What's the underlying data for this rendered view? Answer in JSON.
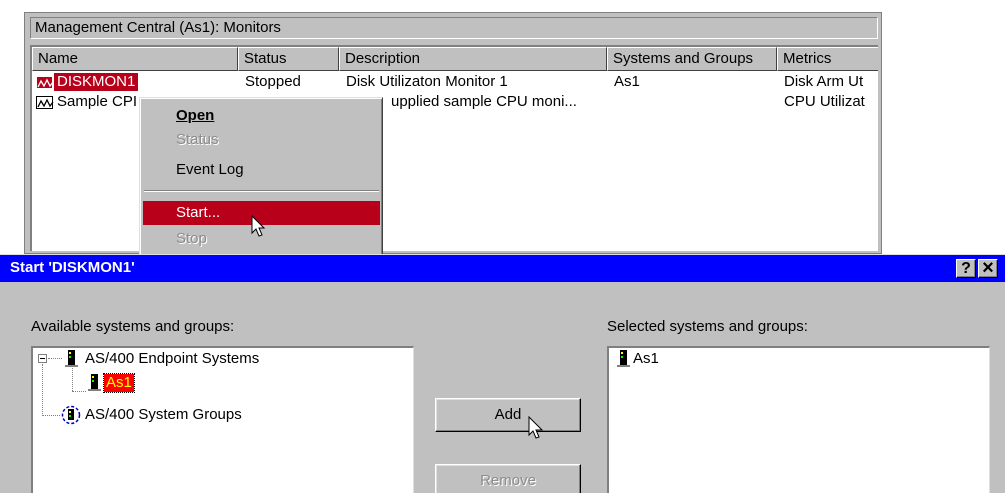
{
  "monitors_window": {
    "title": "Management Central (As1):  Monitors",
    "columns": [
      "Name",
      "Status",
      "Description",
      "Systems and Groups",
      "Metrics"
    ],
    "rows": [
      {
        "name": "DISKMON1",
        "status": "Stopped",
        "description": "Disk Utilizaton Monitor 1",
        "systems": "As1",
        "metrics": "Disk Arm Ut",
        "selected": true
      },
      {
        "name": "Sample CPI",
        "status": "",
        "description": "upplied sample CPU moni...",
        "systems": "",
        "metrics": "CPU Utilizat",
        "selected": false
      }
    ]
  },
  "context_menu": {
    "open": "Open",
    "status": "Status",
    "event_log": "Event Log",
    "start": "Start...",
    "stop": "Stop"
  },
  "dialog": {
    "title": "Start 'DISKMON1'",
    "help_glyph": "?",
    "close_glyph": "×",
    "available_label": "Available systems and groups:",
    "selected_label": "Selected systems and groups:",
    "tree": {
      "endpoint_systems": "AS/400 Endpoint Systems",
      "as1": "As1",
      "system_groups": "AS/400 System Groups"
    },
    "selected_items": [
      "As1"
    ],
    "add_button": "Add",
    "remove_button": "Remove"
  },
  "colors": {
    "highlight": "#b8001a",
    "title_bar": "#0000ff",
    "tree_selection": "#ff0000"
  }
}
